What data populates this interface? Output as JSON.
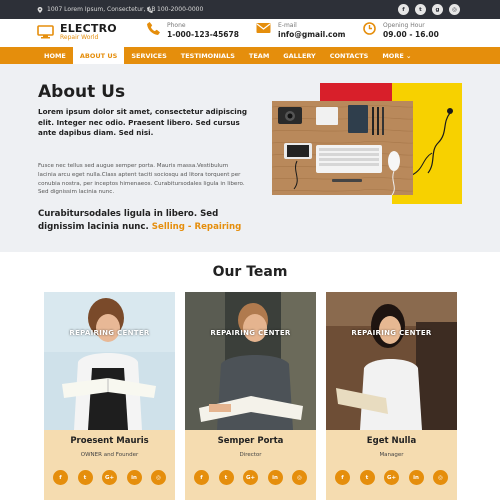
{
  "topbar": {
    "address": "1007 Lorem Ipsum, Consectetur, AB",
    "phone": "100-2000-0000",
    "socials": [
      {
        "icon": "facebook-icon",
        "glyph": "f"
      },
      {
        "icon": "twitter-icon",
        "glyph": "t"
      },
      {
        "icon": "google-plus-icon",
        "glyph": "g"
      },
      {
        "icon": "instagram-icon",
        "glyph": "◎"
      }
    ]
  },
  "header": {
    "brand": "ELECTRO",
    "tagline": "Repair World",
    "phone_label": "Phone",
    "phone_value": "1-000-123-45678",
    "email_label": "E-mail",
    "email_value": "info@gmail.com",
    "hours_label": "Opening Hour",
    "hours_value": "09.00 - 16.00"
  },
  "nav": {
    "items": [
      "HOME",
      "ABOUT US",
      "SERVICES",
      "TESTIMONIALS",
      "TEAM",
      "GALLERY",
      "CONTACTS",
      "MORE ⌄"
    ],
    "active_index": 1
  },
  "about": {
    "title": "About Us",
    "lead": "Lorem ipsum dolor sit amet, consectetur adipiscing elit. Integer nec odio. Praesent libero. Sed cursus ante dapibus diam. Sed nisi.",
    "body": "Fusce nec tellus sed augue semper porta. Mauris massa.Vestibulum lacinia arcu eget nulla.Class aptent taciti sociosqu ad litora torquent per conubia nostra, per inceptos himenaeos. Curabitursodales ligula in libero. Sed dignissim lacinia nunc.",
    "cta_text": "Curabitursodales ligula in libero. Sed dignissim lacinia nunc.",
    "cta_highlight": "Selling - Repairing"
  },
  "team": {
    "title": "Our Team",
    "members": [
      {
        "caption": "REPAIRING CENTER",
        "name": "Proesent Mauris",
        "role": "OWNER and Founder"
      },
      {
        "caption": "REPAIRING CENTER",
        "name": "Semper Porta",
        "role": "Director"
      },
      {
        "caption": "REPAIRING CENTER",
        "name": "Eget Nulla",
        "role": "Manager"
      }
    ],
    "social_glyphs": [
      "f",
      "t",
      "G+",
      "in",
      "◎"
    ]
  },
  "colors": {
    "accent": "#e58e0c",
    "topbar": "#2d3038",
    "about_bg": "#eef0f3",
    "card_info": "#f5dcb0"
  }
}
